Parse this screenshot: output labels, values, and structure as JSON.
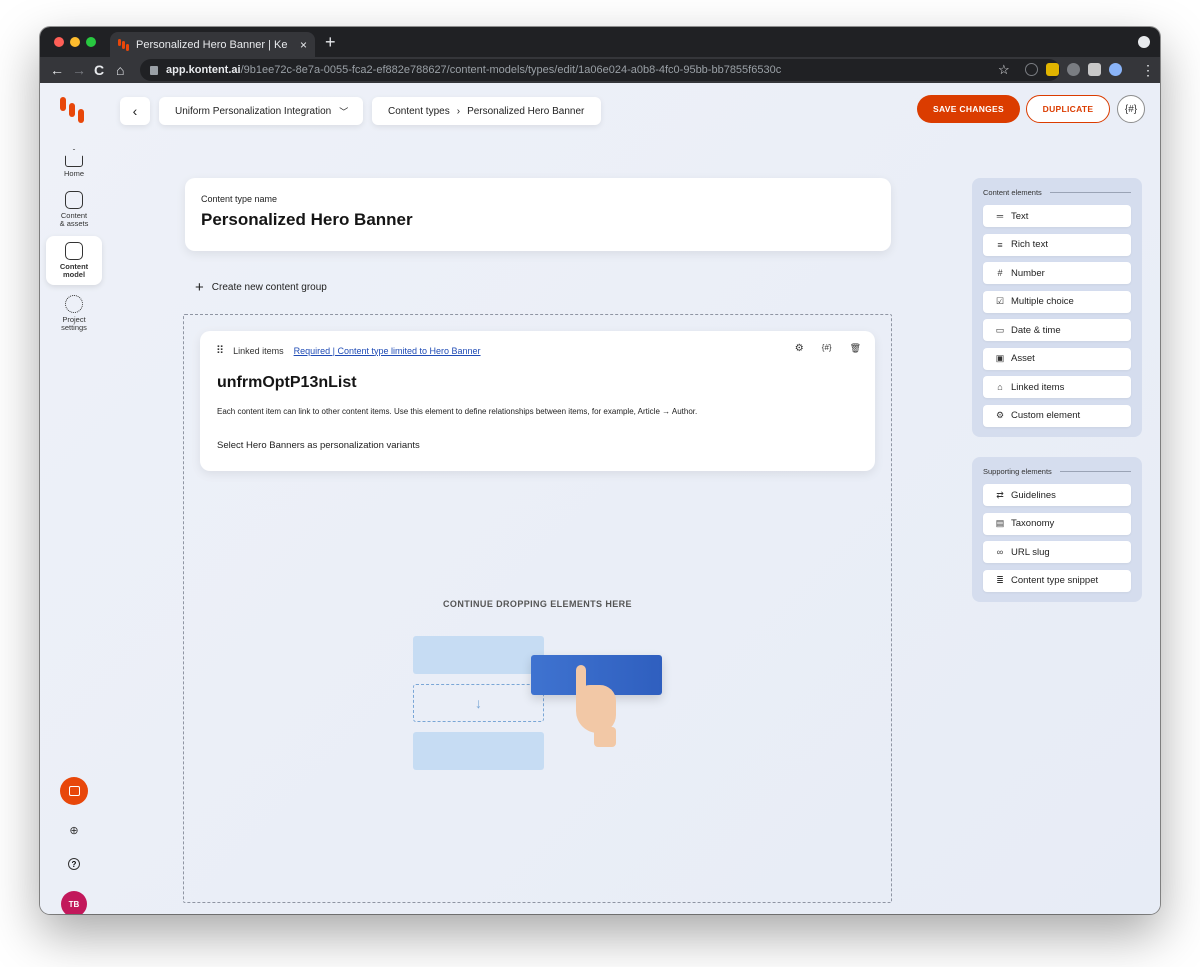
{
  "browser": {
    "tab_title": "Personalized Hero Banner | Ke",
    "tab_close": "×",
    "new_tab": "+",
    "url_host": "app.kontent.ai",
    "url_path": "/9b1ee72c-8e7a-0055-fca2-ef882e788627/content-models/types/edit/1a06e024-a0b8-4fc0-95bb-bb7855f6530c",
    "back": "←",
    "forward": "→",
    "reload": "C",
    "home": "⌂",
    "star": "☆"
  },
  "sidebar": {
    "items": [
      {
        "label_1": "Home",
        "label_2": ""
      },
      {
        "label_1": "Content",
        "label_2": "& assets"
      },
      {
        "label_1": "Content",
        "label_2": "model"
      },
      {
        "label_1": "Project",
        "label_2": "settings"
      }
    ],
    "user_initials": "TB",
    "help": "?"
  },
  "topbar": {
    "back": "‹",
    "project": "Uniform Personalization Integration",
    "breadcrumb_parent": "Content types",
    "breadcrumb_sep": "›",
    "breadcrumb_current": "Personalized Hero Banner",
    "save": "SAVE CHANGES",
    "duplicate": "DUPLICATE",
    "codename": "{#}"
  },
  "content_type": {
    "name_label": "Content type name",
    "name_value": "Personalized Hero Banner"
  },
  "create_group": {
    "icon": "+",
    "label": "Create new content group"
  },
  "element": {
    "drag": "⠿",
    "type": "Linked items",
    "requirement": "Required | Content type limited to Hero Banner",
    "name": "unfrmOptP13nList",
    "guidelines": "Each content item can link to other content items. Use this element to define relationships between items, for example, Article → Author.",
    "description": "Select Hero Banners as personalization variants",
    "actions": {
      "settings": "⚙",
      "codename": "{#}",
      "delete": "🗑"
    }
  },
  "dropzone": {
    "label": "CONTINUE DROPPING ELEMENTS HERE",
    "arrow": "↓"
  },
  "content_elements": {
    "title": "Content elements",
    "items": [
      {
        "icon": "═",
        "label": "Text"
      },
      {
        "icon": "≡",
        "label": "Rich text"
      },
      {
        "icon": "#",
        "label": "Number"
      },
      {
        "icon": "☑",
        "label": "Multiple choice"
      },
      {
        "icon": "▭",
        "label": "Date & time"
      },
      {
        "icon": "▣",
        "label": "Asset"
      },
      {
        "icon": "⌂",
        "label": "Linked items"
      },
      {
        "icon": "⚙",
        "label": "Custom element"
      }
    ]
  },
  "supporting_elements": {
    "title": "Supporting elements",
    "items": [
      {
        "icon": "⇄",
        "label": "Guidelines"
      },
      {
        "icon": "▤",
        "label": "Taxonomy"
      },
      {
        "icon": "∞",
        "label": "URL slug"
      },
      {
        "icon": "≣",
        "label": "Content type snippet"
      }
    ]
  },
  "colors": {
    "brand": "#db3c00",
    "link": "#1f4bb5",
    "avatar": "#c2185b"
  }
}
